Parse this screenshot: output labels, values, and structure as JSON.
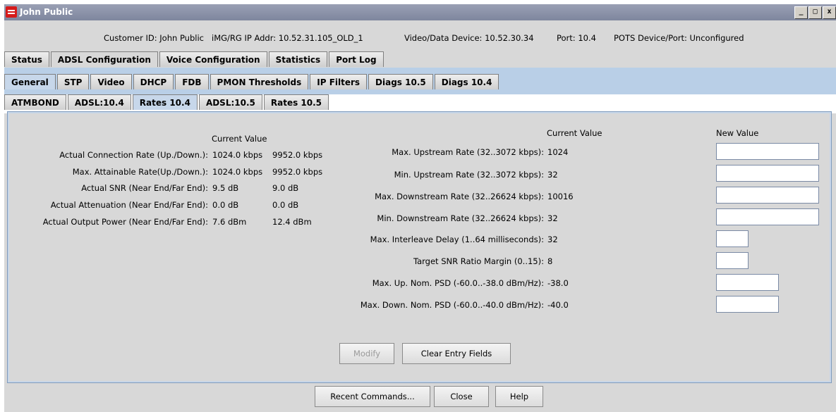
{
  "window": {
    "title": "John Public"
  },
  "info": {
    "customer": "Customer ID: John Public",
    "ip_addr": "iMG/RG IP Addr: 10.52.31.105_OLD_1",
    "device": "Video/Data Device: 10.52.30.34",
    "port": "Port: 10.4",
    "pots": "POTS Device/Port: Unconfigured"
  },
  "tabs_main": [
    "Status",
    "ADSL Configuration",
    "Voice Configuration",
    "Statistics",
    "Port Log"
  ],
  "tabs_sub": [
    "General",
    "STP",
    "Video",
    "DHCP",
    "FDB",
    "PMON Thresholds",
    "IP Filters",
    "Diags 10.5",
    "Diags 10.4"
  ],
  "tabs_rate": [
    "ATMBOND",
    "ADSL:10.4",
    "Rates 10.4",
    "ADSL:10.5",
    "Rates 10.5"
  ],
  "left": {
    "header": "Current Value",
    "rows": [
      {
        "label": "Actual Connection Rate (Up./Down.):",
        "up": "1024.0 kbps",
        "down": "9952.0 kbps"
      },
      {
        "label": "Max. Attainable Rate(Up./Down.):",
        "up": "1024.0 kbps",
        "down": "9952.0 kbps"
      },
      {
        "label": "Actual SNR (Near End/Far End):",
        "up": "9.5 dB",
        "down": "9.0 dB"
      },
      {
        "label": "Actual Attenuation (Near End/Far End):",
        "up": "0.0 dB",
        "down": "0.0 dB"
      },
      {
        "label": "Actual Output Power (Near End/Far End):",
        "up": "7.6 dBm",
        "down": "12.4 dBm"
      }
    ]
  },
  "right": {
    "current_header": "Current Value",
    "new_header": "New Value",
    "rows": [
      {
        "label": "Max. Upstream Rate (32..3072 kbps):",
        "value": "1024"
      },
      {
        "label": "Min. Upstream Rate (32..3072 kbps):",
        "value": "32"
      },
      {
        "label": "Max. Downstream Rate (32..26624 kbps):",
        "value": "10016"
      },
      {
        "label": "Min. Downstream Rate (32..26624 kbps):",
        "value": "32"
      },
      {
        "label": "Max. Interleave Delay (1..64 milliseconds):",
        "value": "32"
      },
      {
        "label": "Target SNR Ratio Margin (0..15):",
        "value": "8"
      },
      {
        "label": "Max. Up. Nom. PSD (-60.0..-38.0 dBm/Hz):",
        "value": "-38.0"
      },
      {
        "label": "Max. Down. Nom. PSD (-60.0..-40.0 dBm/Hz):",
        "value": "-40.0"
      }
    ]
  },
  "buttons": {
    "modify": "Modify",
    "clear": "Clear Entry Fields",
    "recent": "Recent Commands...",
    "close": "Close",
    "help": "Help"
  },
  "window_buttons": {
    "minimize": "_",
    "maximize": "□",
    "close": "x"
  }
}
